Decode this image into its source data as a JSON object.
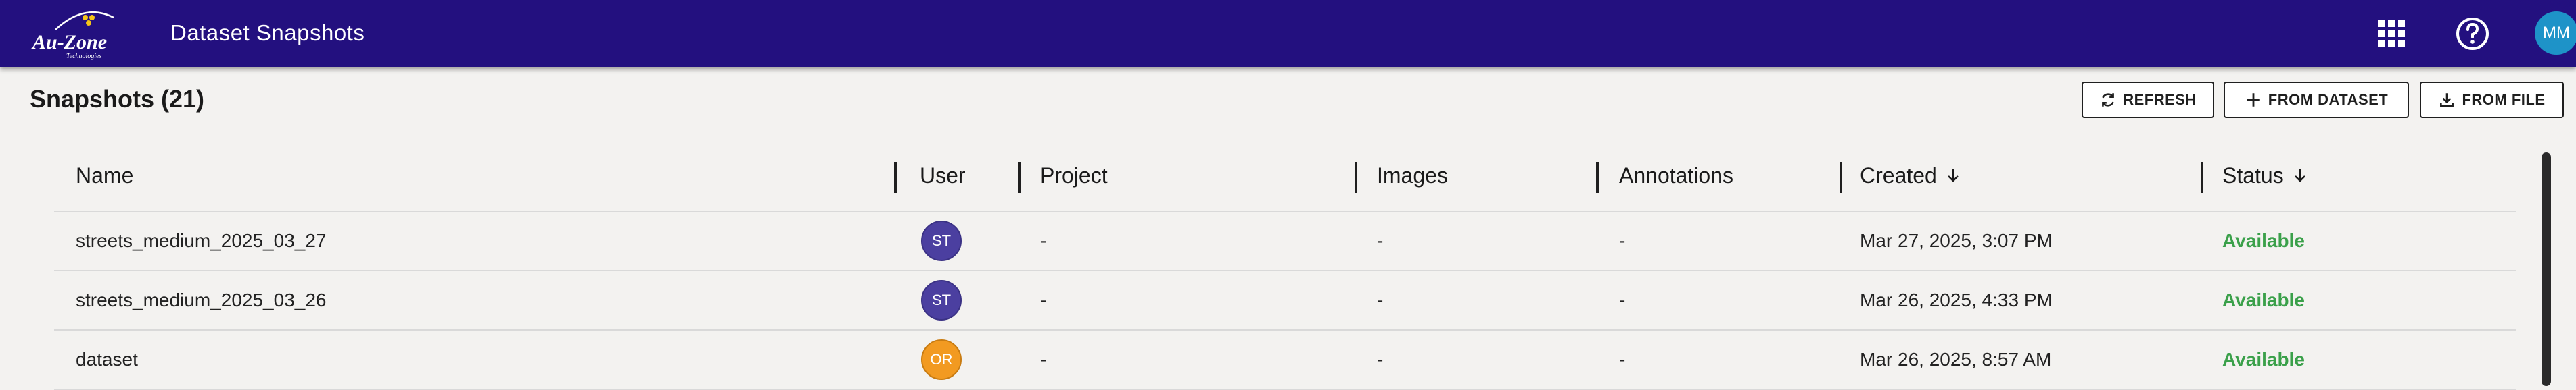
{
  "app": {
    "title": "Dataset Snapshots",
    "logo_text": "Au-Zone",
    "logo_sub": "Technologies",
    "user_initials": "MM",
    "colors": {
      "appbar": "#23107f",
      "status_available": "#3aa04a",
      "user_avatar": "#4b3fa0",
      "alt_avatar": "#f29a21"
    }
  },
  "toolbar": {
    "title": "Snapshots (21)",
    "refresh_label": "REFRESH",
    "from_dataset_label": "FROM DATASET",
    "from_file_label": "FROM FILE"
  },
  "table": {
    "columns": {
      "name": "Name",
      "user": "User",
      "project": "Project",
      "images": "Images",
      "annotations": "Annotations",
      "created": "Created",
      "status": "Status"
    },
    "rows": [
      {
        "name": "streets_medium_2025_03_27",
        "user": "ST",
        "user_color": "#4b3fa0",
        "project": "-",
        "images": "-",
        "annotations": "-",
        "created": "Mar 27, 2025, 3:07 PM",
        "status": "Available"
      },
      {
        "name": "streets_medium_2025_03_26",
        "user": "ST",
        "user_color": "#4b3fa0",
        "project": "-",
        "images": "-",
        "annotations": "-",
        "created": "Mar 26, 2025, 4:33 PM",
        "status": "Available"
      },
      {
        "name": "dataset",
        "user": "OR",
        "user_color": "#f29a21",
        "project": "-",
        "images": "-",
        "annotations": "-",
        "created": "Mar 26, 2025, 8:57 AM",
        "status": "Available"
      }
    ]
  }
}
